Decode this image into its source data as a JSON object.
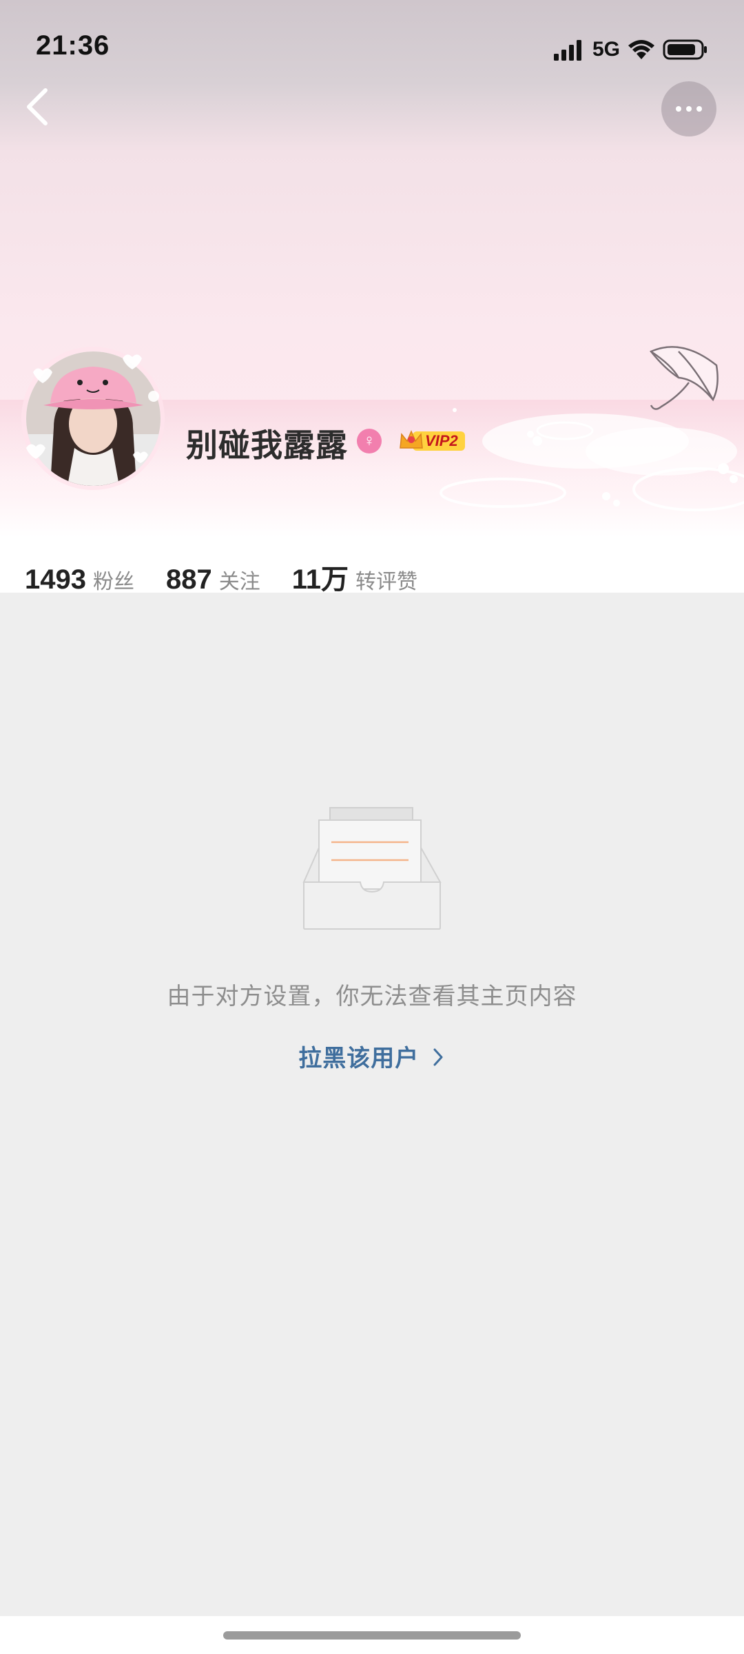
{
  "status_bar": {
    "time": "21:36",
    "network": "5G",
    "icons": [
      "signal-icon",
      "wifi-icon",
      "battery-icon"
    ]
  },
  "nav": {
    "back_icon": "chevron-left-icon",
    "more_icon": "more-dots-icon"
  },
  "profile": {
    "username": "别碰我露露",
    "gender_icon": "female-icon",
    "gender_symbol": "♀",
    "vip_label": "VIP2",
    "stats": [
      {
        "value": "1493",
        "label": "粉丝"
      },
      {
        "value": "887",
        "label": "关注"
      },
      {
        "value": "11万",
        "label": "转评赞"
      }
    ]
  },
  "content": {
    "empty_message": "由于对方设置，你无法查看其主页内容",
    "block_link": "拉黑该用户",
    "block_link_icon": "chevron-right-icon"
  },
  "colors": {
    "link": "#3f6e9d",
    "gender_badge": "#f27fae",
    "content_bg": "#eeeeee"
  }
}
